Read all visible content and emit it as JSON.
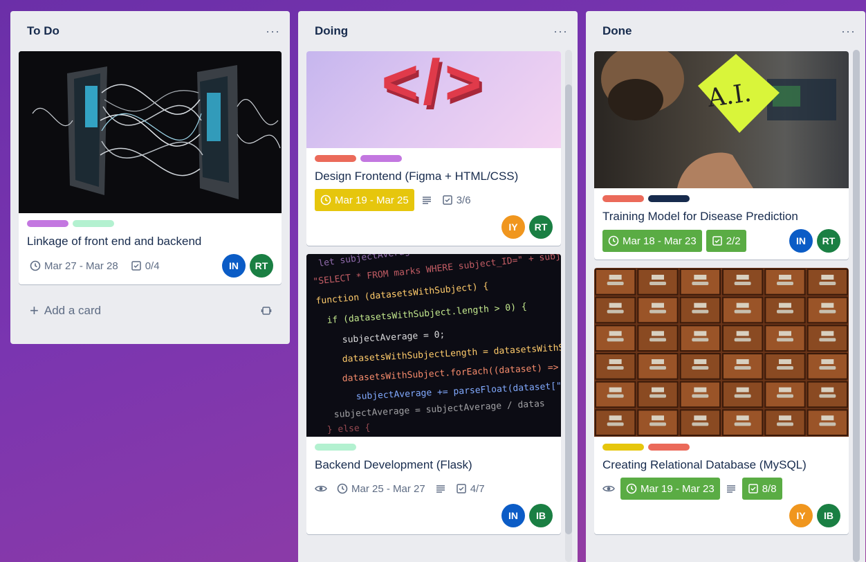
{
  "colors": {
    "label_purple": "#c377e0",
    "label_green": "#b3f1d0",
    "label_red": "#eb6a5a",
    "label_navy": "#172b4d",
    "label_yellow": "#e6c60d",
    "badge_green": "#5aac44",
    "badge_yellow": "#e6c60d",
    "avatar_in": "#0b5cc6",
    "avatar_rt": "#1a7f43",
    "avatar_iy": "#f0961e",
    "avatar_ib": "#1a7f43"
  },
  "lists": {
    "todo": {
      "title": "To Do",
      "menu": "···",
      "add_card": "Add a card",
      "cards": {
        "linkage": {
          "title": "Linkage of front end and backend",
          "dates": "Mar 27 - Mar 28",
          "checklist": "0/4",
          "members": [
            "IN",
            "RT"
          ]
        }
      }
    },
    "doing": {
      "title": "Doing",
      "menu": "···",
      "cards": {
        "design": {
          "cover_text": "</>",
          "title": "Design Frontend (Figma + HTML/CSS)",
          "dates": "Mar 19 - Mar 25",
          "checklist": "3/6",
          "members": [
            "IY",
            "RT"
          ]
        },
        "backend": {
          "title": "Backend Development (Flask)",
          "dates": "Mar 25 - Mar 27",
          "checklist": "4/7",
          "members": [
            "IN",
            "IB"
          ]
        }
      }
    },
    "done": {
      "title": "Done",
      "menu": "···",
      "cards": {
        "training": {
          "cover_text": "A.I.",
          "title": "Training Model for Disease Prediction",
          "dates": "Mar 18 - Mar 23",
          "checklist": "2/2",
          "members": [
            "IN",
            "RT"
          ]
        },
        "database": {
          "title": "Creating Relational Database (MySQL)",
          "dates": "Mar 19 - Mar 23",
          "checklist": "8/8",
          "members": [
            "IY",
            "IB"
          ]
        }
      }
    }
  }
}
